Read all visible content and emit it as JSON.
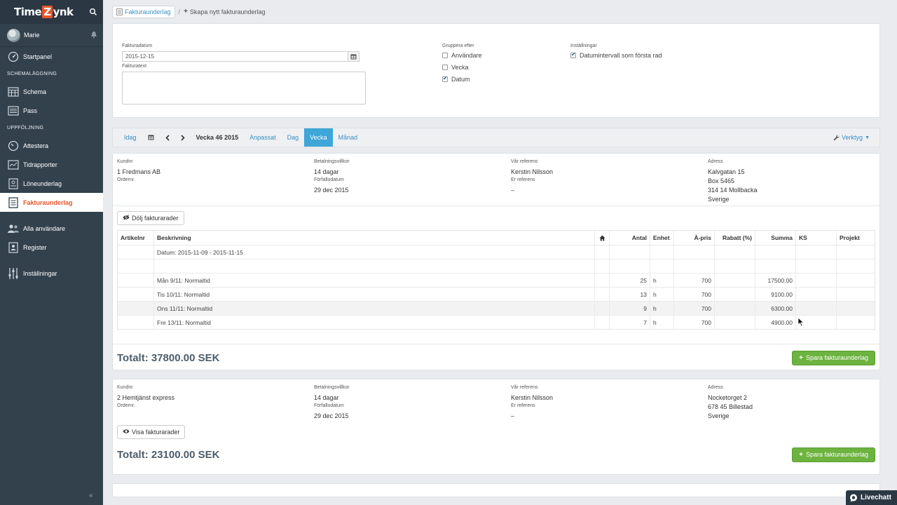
{
  "app": {
    "logo_pre": "Time",
    "logo_z": "Z",
    "logo_post": "ynk"
  },
  "user": {
    "name": "Marie"
  },
  "nav": {
    "start": "Startpanel",
    "section_schedule": "Schemaläggning",
    "schema": "Schema",
    "pass": "Pass",
    "section_followup": "Uppföljning",
    "attestera": "Attestera",
    "tidrapporter": "Tidrapporter",
    "loneunderlag": "Löneunderlag",
    "fakturaunderlag": "Fakturaunderlag",
    "alla_anvandare": "Alla användare",
    "register": "Register",
    "installningar": "Inställningar"
  },
  "breadcrumb": {
    "parent": "Fakturaunderlag",
    "sep": "/",
    "current": "Skapa nytt fakturaunderlag"
  },
  "form": {
    "date_label": "Fakturadatum",
    "date_value": "2015-12-15",
    "text_label": "Fakturatext",
    "group_label": "Gruppera efter",
    "group_user": "Användare",
    "group_week": "Vecka",
    "group_date": "Datum",
    "group_user_checked": false,
    "group_week_checked": false,
    "group_date_checked": true,
    "settings_label": "Inställningar",
    "settings_option": "Datumintervall som första rad",
    "settings_option_checked": true
  },
  "toolbar": {
    "today": "Idag",
    "week_label": "Vecka 46 2015",
    "custom": "Anpassat",
    "day": "Dag",
    "week": "Vecka",
    "month": "Månad",
    "tools": "Verktyg"
  },
  "invoices": [
    {
      "customer_label": "Kundnr",
      "customer": "1 Fredmans AB",
      "order_label": "Ordernr.",
      "terms_label": "Betalningsvillkor",
      "terms": "14 dagar",
      "due_label": "Förfallodatum",
      "due": "29 dec 2015",
      "ourref_label": "Vår referens",
      "ourref": "Kerstin Nilsson",
      "yourref_label": "Er referens",
      "yourref": "–",
      "address_label": "Adress",
      "address": [
        "Kalvgatan 15",
        "Box 5465",
        "314 14 Mollbacka",
        "Sverige"
      ],
      "toggle_label": "Dölj fakturarader",
      "table": {
        "headers": [
          "Artikelnr",
          "Beskrivning",
          "",
          "Antal",
          "Enhet",
          "À-pris",
          "Rabatt (%)",
          "Summa",
          "KS",
          "Projekt"
        ],
        "rows": [
          [
            "",
            "Datum: 2015-11-09 - 2015-11-15",
            "",
            "",
            "",
            "",
            "",
            "",
            "",
            ""
          ],
          [
            "",
            "",
            "",
            "",
            "",
            "",
            "",
            "",
            "",
            ""
          ],
          [
            "",
            "Mån 9/11: Normaltid",
            "",
            "25",
            "h",
            "700",
            "",
            "17500.00",
            "",
            ""
          ],
          [
            "",
            "Tis 10/11: Normaltid",
            "",
            "13",
            "h",
            "700",
            "",
            "9100.00",
            "",
            ""
          ],
          [
            "",
            "Ons 11/11: Normaltid",
            "",
            "9",
            "h",
            "700",
            "",
            "6300.00",
            "",
            ""
          ],
          [
            "",
            "Fre 13/11: Normaltid",
            "",
            "7",
            "h",
            "700",
            "",
            "4900.00",
            "",
            ""
          ]
        ]
      },
      "total": "Totalt: 37800.00 SEK",
      "save_label": "Spara fakturaunderlag"
    },
    {
      "customer_label": "Kundnr",
      "customer": "2 Hemtjänst express",
      "order_label": "Ordernr.",
      "terms_label": "Betalningsvillkor",
      "terms": "14 dagar",
      "due_label": "Förfallodatum",
      "due": "29 dec 2015",
      "ourref_label": "Vår referens",
      "ourref": "Kerstin Nilsson",
      "yourref_label": "Er referens",
      "yourref": "–",
      "address_label": "Adress",
      "address": [
        "Nocketorget 2",
        "678 45 Billestad",
        "Sverige"
      ],
      "toggle_label": "Visa fakturarader",
      "total": "Totalt: 23100.00 SEK",
      "save_label": "Spara fakturaunderlag"
    }
  ],
  "livechat": "Livechatt"
}
